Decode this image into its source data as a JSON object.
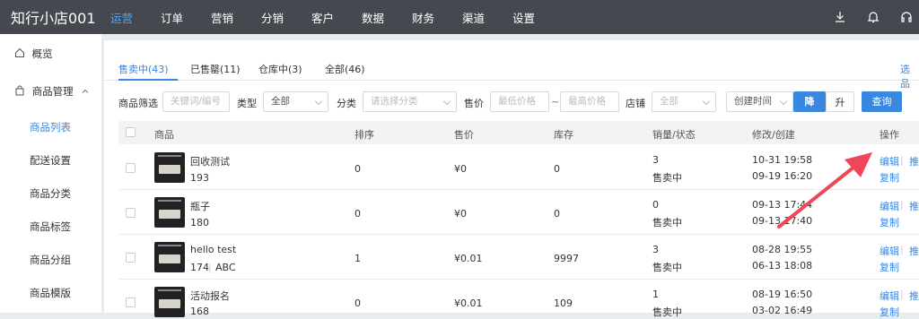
{
  "brand": "知行小店001",
  "nav": [
    "运营",
    "订单",
    "营销",
    "分销",
    "客户",
    "数据",
    "财务",
    "渠道",
    "设置"
  ],
  "sidebar": {
    "overview": "概览",
    "goods_mgmt": "商品管理",
    "items": [
      "商品列表",
      "配送设置",
      "商品分类",
      "商品标签",
      "商品分组",
      "商品模版"
    ]
  },
  "tabs": [
    "售卖中(43)",
    "已售罄(11)",
    "仓库中(3)",
    "全部(46)"
  ],
  "tabs_right": "选品",
  "filter": {
    "goods_label": "商品筛选",
    "keyword_placeholder": "关键词/编号",
    "type_label": "类型",
    "type_value": "全部",
    "category_label": "分类",
    "category_placeholder": "请选择分类",
    "price_label": "售价",
    "min_placeholder": "最低价格",
    "tilde": "~",
    "max_placeholder": "最高价格",
    "store_label": "店铺",
    "store_value": "全部",
    "sort_value": "创建时间",
    "desc": "降",
    "asc": "升",
    "query": "查询"
  },
  "columns": [
    "商品",
    "排序",
    "售价",
    "库存",
    "销量/状态",
    "修改/创建",
    "操作"
  ],
  "rows": [
    {
      "name": "回收测试",
      "sub": "193",
      "sub2": "",
      "order": "0",
      "price": "¥0",
      "stock": "0",
      "sales": "3",
      "status": "售卖中",
      "modified": "10-31 19:58",
      "created": "09-19 16:20"
    },
    {
      "name": "瓶子",
      "sub": "180",
      "sub2": "",
      "order": "0",
      "price": "¥0",
      "stock": "0",
      "sales": "0",
      "status": "售卖中",
      "modified": "09-13 17:44",
      "created": "09-13 17:40"
    },
    {
      "name": "hello test",
      "sub": "174",
      "sub2": "ABC",
      "order": "1",
      "price": "¥0.01",
      "stock": "9997",
      "sales": "3",
      "status": "售卖中",
      "modified": "08-28 19:55",
      "created": "06-13 18:08"
    },
    {
      "name": "活动报名",
      "sub": "168",
      "sub2": "",
      "order": "0",
      "price": "¥0.01",
      "stock": "109",
      "sales": "1",
      "status": "售卖中",
      "modified": "08-19 16:50",
      "created": "03-02 16:49"
    }
  ],
  "actions": {
    "edit": "编辑",
    "promote": "推",
    "copy": "复制"
  },
  "colors": {
    "topbar": "#45484f",
    "accent": "#3a87e0",
    "arrow": "#f0465a"
  },
  "icons": [
    "download-icon",
    "bell-icon",
    "headset-icon",
    "home-icon",
    "bag-icon",
    "chevron-up-icon"
  ]
}
